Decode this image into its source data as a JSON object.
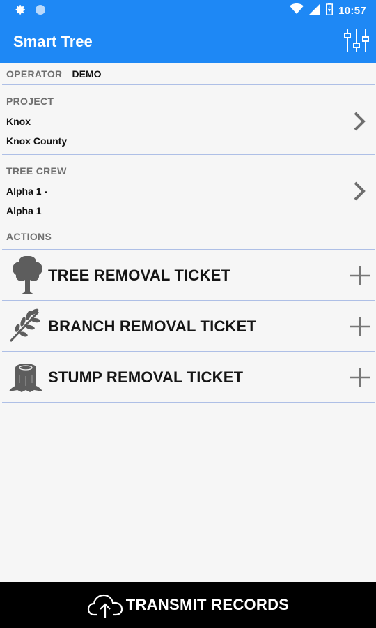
{
  "status_bar": {
    "time": "10:57"
  },
  "app_bar": {
    "title": "Smart Tree",
    "settings_icon": "sliders-icon"
  },
  "operator": {
    "label": "OPERATOR",
    "value": "DEMO"
  },
  "project": {
    "label": "PROJECT",
    "line1": "Knox",
    "line2": "Knox County"
  },
  "tree_crew": {
    "label": "TREE CREW",
    "line1": "Alpha 1 -",
    "line2": "Alpha 1"
  },
  "actions": {
    "label": "ACTIONS",
    "items": [
      {
        "label": "TREE REMOVAL TICKET",
        "icon": "tree-icon"
      },
      {
        "label": "BRANCH REMOVAL TICKET",
        "icon": "branch-icon"
      },
      {
        "label": "STUMP REMOVAL TICKET",
        "icon": "stump-icon"
      }
    ]
  },
  "bottom": {
    "label": "TRANSMIT RECORDS",
    "icon": "cloud-upload-icon"
  },
  "colors": {
    "primary": "#1e88f5",
    "divider": "#aebfe6",
    "bottom_bar": "#000000"
  }
}
